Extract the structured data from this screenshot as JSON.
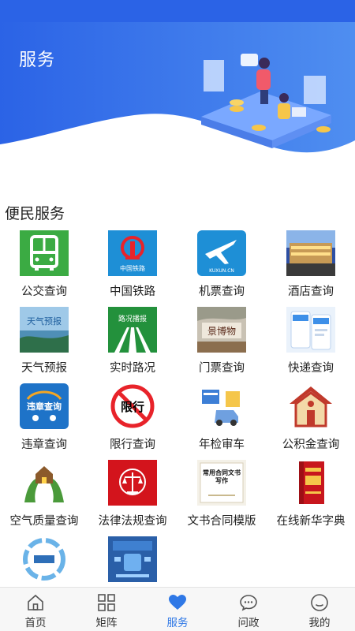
{
  "header": {
    "title": "服务"
  },
  "section": {
    "title": "便民服务"
  },
  "services": [
    {
      "label": "公交查询",
      "icon": "bus-icon"
    },
    {
      "label": "中国铁路",
      "icon": "china-railway-icon",
      "icon_text": "中国铁路"
    },
    {
      "label": "机票查询",
      "icon": "airplane-icon",
      "icon_text": "KUXUN.CN"
    },
    {
      "label": "酒店查询",
      "icon": "hotel-photo"
    },
    {
      "label": "天气预报",
      "icon": "weather-photo",
      "icon_text": "天气预报"
    },
    {
      "label": "实时路况",
      "icon": "road-report-icon",
      "icon_text": "路况播报"
    },
    {
      "label": "门票查询",
      "icon": "ticket-photo",
      "icon_text": "景博物"
    },
    {
      "label": "快递查询",
      "icon": "express-screenshot-icon"
    },
    {
      "label": "违章查询",
      "icon": "traffic-violation-icon",
      "icon_text": "违章查询"
    },
    {
      "label": "限行查询",
      "icon": "restriction-sign-icon",
      "icon_text": "限行"
    },
    {
      "label": "年检审车",
      "icon": "car-inspection-icon"
    },
    {
      "label": "公积金查询",
      "icon": "housing-fund-icon"
    },
    {
      "label": "空气质量查询",
      "icon": "air-quality-icon"
    },
    {
      "label": "法律法规查询",
      "icon": "law-icon"
    },
    {
      "label": "文书合同模版",
      "icon": "contract-book-icon",
      "icon_text": "常用合同文书写作"
    },
    {
      "label": "在线新华字典",
      "icon": "dictionary-icon"
    },
    {
      "label": "",
      "icon": "e-government-icon"
    },
    {
      "label": "",
      "icon": "platform-screen-icon"
    }
  ],
  "tabbar": [
    {
      "label": "首页",
      "icon": "home-icon"
    },
    {
      "label": "矩阵",
      "icon": "grid-icon"
    },
    {
      "label": "服务",
      "icon": "heart-icon",
      "active": true
    },
    {
      "label": "问政",
      "icon": "chat-icon"
    },
    {
      "label": "我的",
      "icon": "user-icon"
    }
  ],
  "colors": {
    "accent": "#2f78e6",
    "header": "#2b63e6"
  }
}
